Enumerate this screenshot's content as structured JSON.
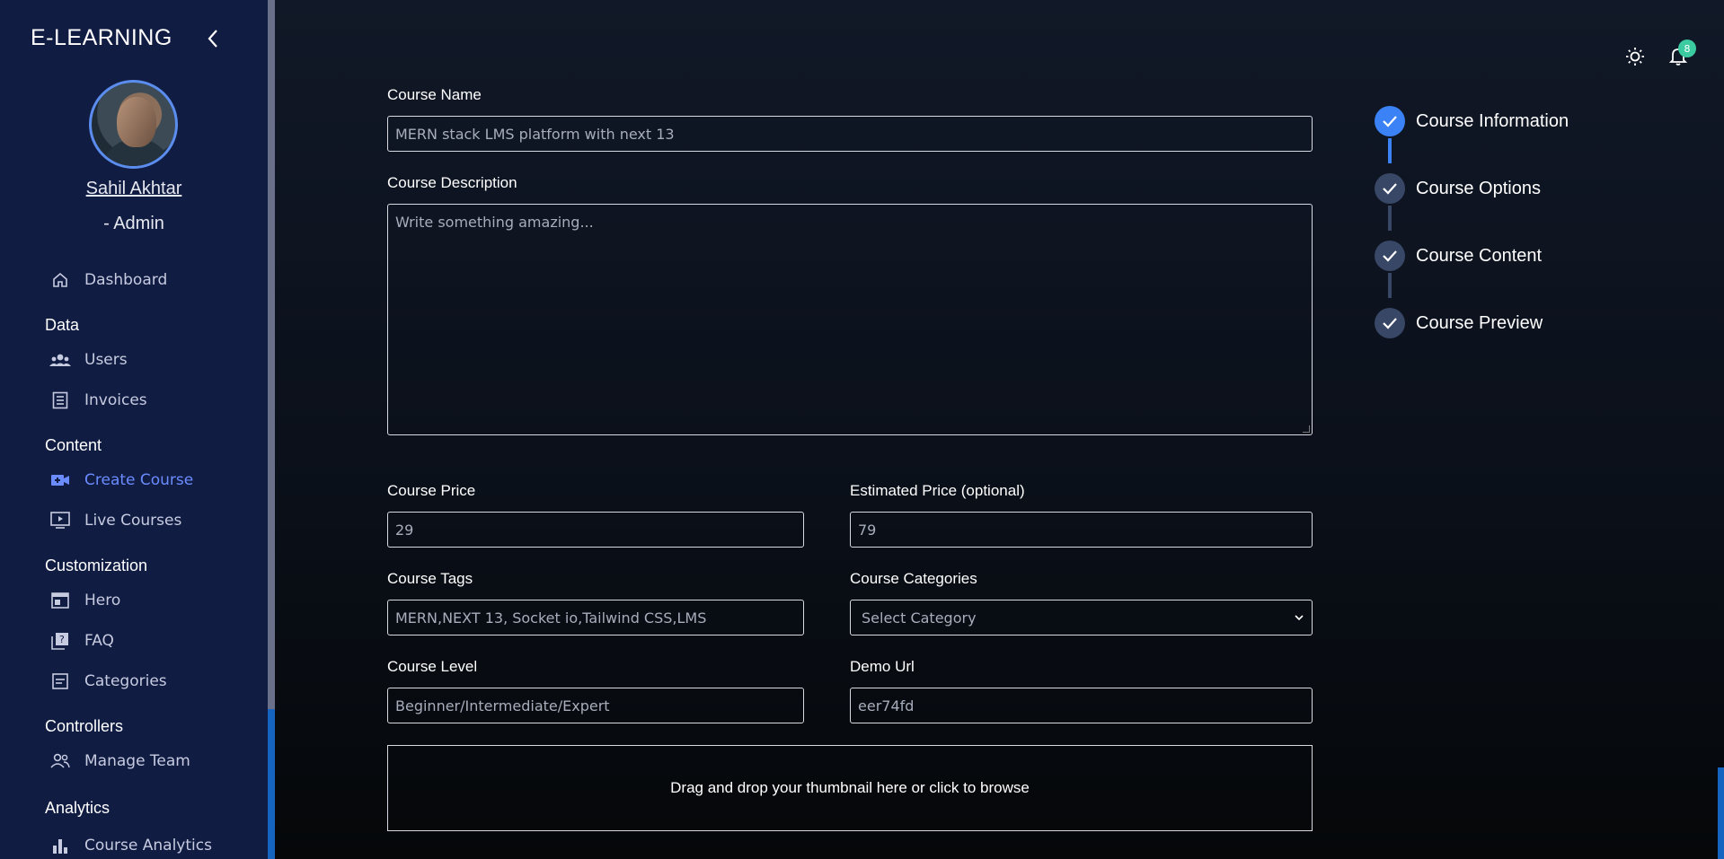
{
  "sidebar": {
    "brand": "E-LEARNING",
    "user_name": "Sahil Akhtar",
    "user_role": "- Admin",
    "items": {
      "dashboard": "Dashboard",
      "users": "Users",
      "invoices": "Invoices",
      "create_course": "Create Course",
      "live_courses": "Live Courses",
      "hero": "Hero",
      "faq": "FAQ",
      "categories": "Categories",
      "manage_team": "Manage Team",
      "course_analytics": "Course Analytics"
    },
    "sections": {
      "data": "Data",
      "content": "Content",
      "customization": "Customization",
      "controllers": "Controllers",
      "analytics": "Analytics"
    },
    "active_item": "Create Course",
    "active_color": "#6b8cff"
  },
  "topbar": {
    "theme_icon": "sun-icon",
    "notifications_icon": "bell-icon",
    "notification_count": "8"
  },
  "form": {
    "course_name_label": "Course Name",
    "course_name_value": "MERN stack LMS platform with next 13",
    "description_label": "Course Description",
    "description_placeholder": "Write something amazing...",
    "price_label": "Course Price",
    "price_value": "29",
    "estimated_price_label": "Estimated Price (optional)",
    "estimated_price_value": "79",
    "tags_label": "Course Tags",
    "tags_value": "MERN,NEXT 13, Socket io,Tailwind CSS,LMS",
    "categories_label": "Course Categories",
    "categories_value": "Select Category",
    "level_label": "Course Level",
    "level_value": "Beginner/Intermediate/Expert",
    "demo_url_label": "Demo Url",
    "demo_url_value": "eer74fd",
    "dropzone_text": "Drag and drop your thumbnail here or click to browse"
  },
  "stepper": {
    "steps": [
      "Course Information",
      "Course Options",
      "Course Content",
      "Course Preview"
    ],
    "current_index": 0,
    "current_color": "#3b82f6",
    "inactive_color": "#384766"
  }
}
